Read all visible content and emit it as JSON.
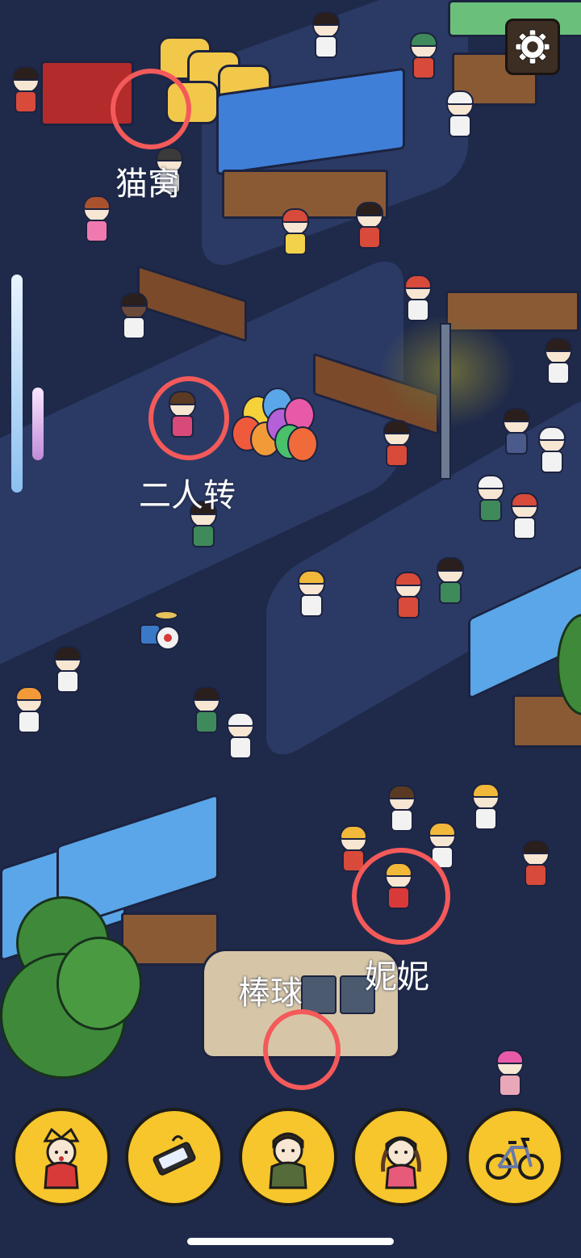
{
  "scene": {
    "colors": {
      "background": "#1f2a4a",
      "marker": "#f45a5a",
      "slot": "#f7c52c"
    }
  },
  "markers": [
    {
      "label": "猫窝"
    },
    {
      "label": "二人转"
    },
    {
      "label": "妮妮"
    },
    {
      "label": "棒球"
    }
  ],
  "hud": {
    "settings_icon": "gear-icon"
  },
  "tray": {
    "slots": [
      {
        "icon": "nini-character-icon"
      },
      {
        "icon": "phone-icon"
      },
      {
        "icon": "soldier-character-icon"
      },
      {
        "icon": "braided-girl-character-icon"
      },
      {
        "icon": "bicycle-icon"
      }
    ]
  }
}
